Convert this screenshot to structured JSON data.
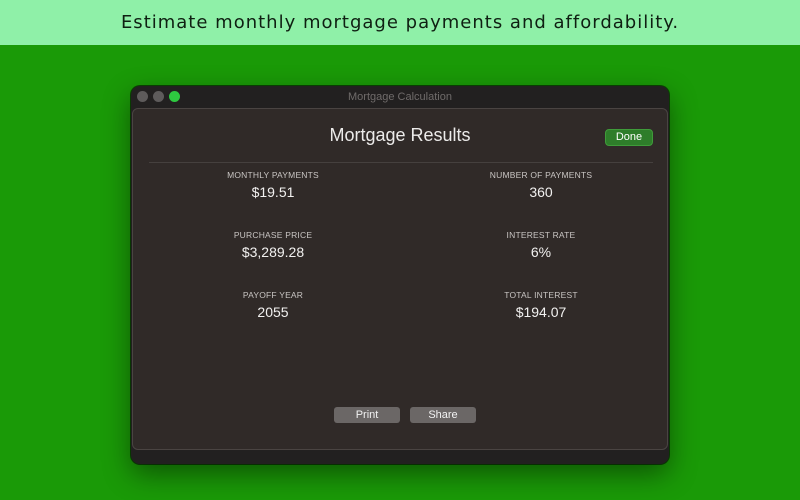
{
  "banner": {
    "text": "Estimate monthly mortgage payments and affordability."
  },
  "window": {
    "title": "Mortgage Calculation"
  },
  "sheet": {
    "title": "Mortgage Results",
    "done_label": "Done"
  },
  "results": [
    {
      "label": "MONTHLY PAYMENTS",
      "value": "$19.51"
    },
    {
      "label": "NUMBER OF PAYMENTS",
      "value": "360"
    },
    {
      "label": "PURCHASE PRICE",
      "value": "$3,289.28"
    },
    {
      "label": "INTEREST RATE",
      "value": "6%"
    },
    {
      "label": "PAYOFF YEAR",
      "value": "2055"
    },
    {
      "label": "TOTAL INTEREST",
      "value": "$194.07"
    }
  ],
  "actions": {
    "print_label": "Print",
    "share_label": "Share"
  },
  "colors": {
    "background": "#1a9a07",
    "banner": "#8ff0a8",
    "done_button": "#2e7d2a",
    "zoom_dot": "#2ec840"
  }
}
